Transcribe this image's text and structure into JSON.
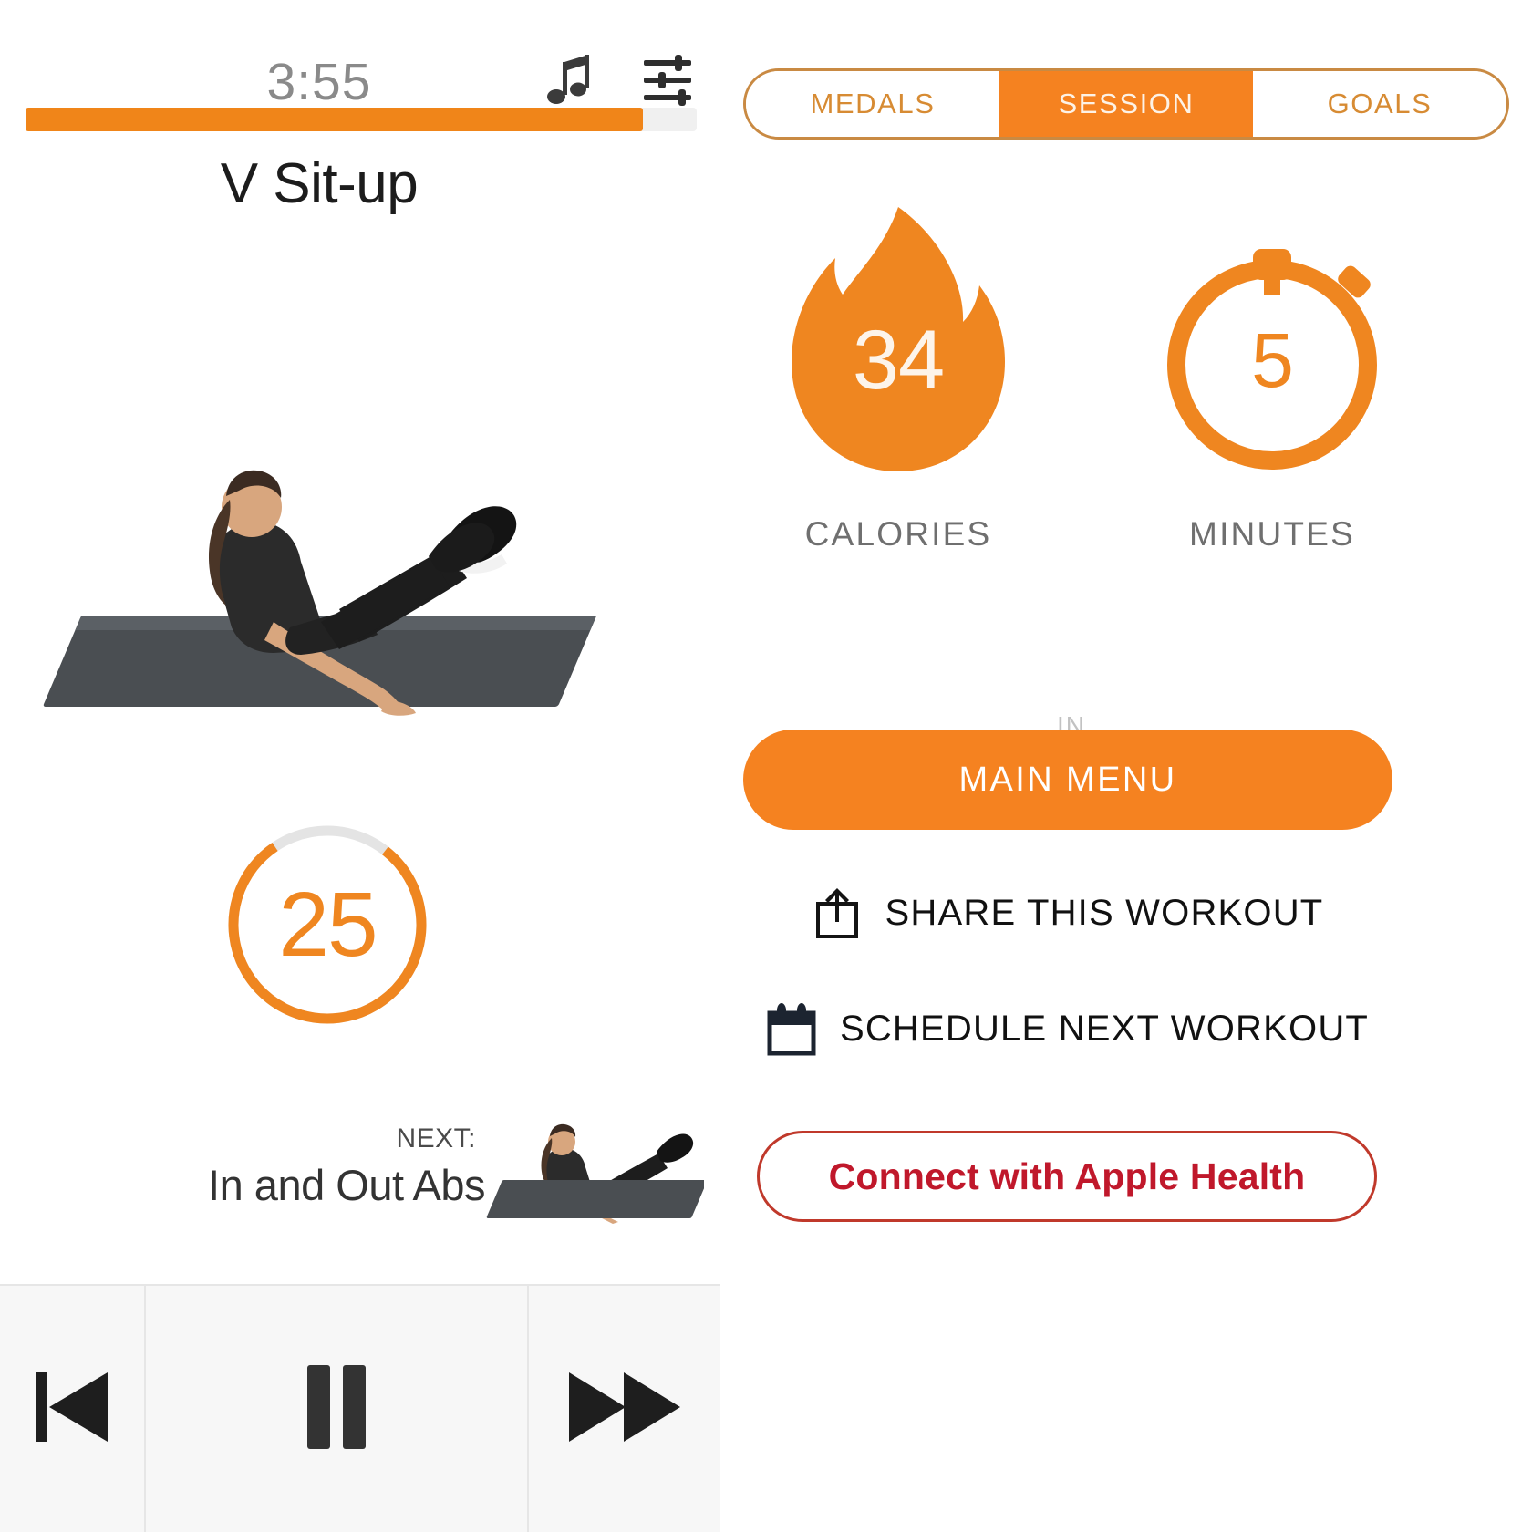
{
  "player": {
    "timer": "3:55",
    "progress_percent": 92,
    "exercise_title": "V Sit-up",
    "rep_count": "25",
    "rep_ring_percent": 80,
    "music_icon": "music-note-icon",
    "settings_icon": "equalizer-icon",
    "next_label": "NEXT:",
    "next_exercise": "In and Out Abs",
    "transport": {
      "previous_label": "previous-track-icon",
      "pause_label": "pause-icon",
      "next_label": "fast-forward-icon"
    }
  },
  "summary": {
    "tabs": [
      {
        "label": "MEDALS",
        "active": false
      },
      {
        "label": "SESSION",
        "active": true
      },
      {
        "label": "GOALS",
        "active": false
      }
    ],
    "stats": {
      "calories_value": "34",
      "calories_label": "CALORIES",
      "connector": "IN",
      "minutes_value": "5",
      "minutes_label": "MINUTES"
    },
    "main_menu_label": "MAIN MENU",
    "actions": [
      {
        "icon": "share-icon",
        "label": "SHARE THIS WORKOUT"
      },
      {
        "icon": "calendar-icon",
        "label": "SCHEDULE NEXT WORKOUT"
      }
    ],
    "health_button_label": "Connect with Apple Health"
  },
  "colors": {
    "orange": "#f58220",
    "orange_deep": "#ef8620",
    "tab_border": "#c98a43",
    "health_red": "#c0182b",
    "label_gray": "#6f6f6f",
    "mat_gray": "#4a4e52"
  }
}
